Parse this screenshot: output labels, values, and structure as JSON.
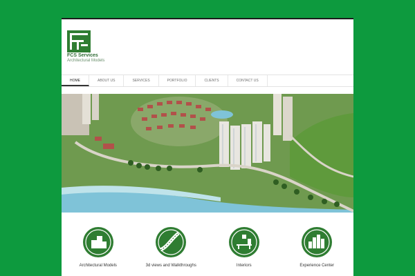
{
  "brand": {
    "name": "FCS Services",
    "tagline": "Architectural Models",
    "logo_icon": "fcs-logo-icon",
    "color": "#2f7d32"
  },
  "nav": {
    "items": [
      {
        "label": "HOME",
        "active": true
      },
      {
        "label": "ABOUT US",
        "active": false
      },
      {
        "label": "SERVICES",
        "active": false
      },
      {
        "label": "PORTFOLIO",
        "active": false
      },
      {
        "label": "CLIENTS",
        "active": false
      },
      {
        "label": "CONTACT US",
        "active": false
      }
    ]
  },
  "hero": {
    "image": "architectural-model-photo"
  },
  "services": [
    {
      "label": "Architectural Models",
      "icon": "buildings-icon"
    },
    {
      "label": "3d views and Walkthroughs",
      "icon": "road-icon"
    },
    {
      "label": "Interiors",
      "icon": "interior-icon"
    },
    {
      "label": "Experience Center",
      "icon": "city-skyline-icon"
    }
  ],
  "colors": {
    "background": "#0d9a3e",
    "accent": "#2f7d32"
  }
}
